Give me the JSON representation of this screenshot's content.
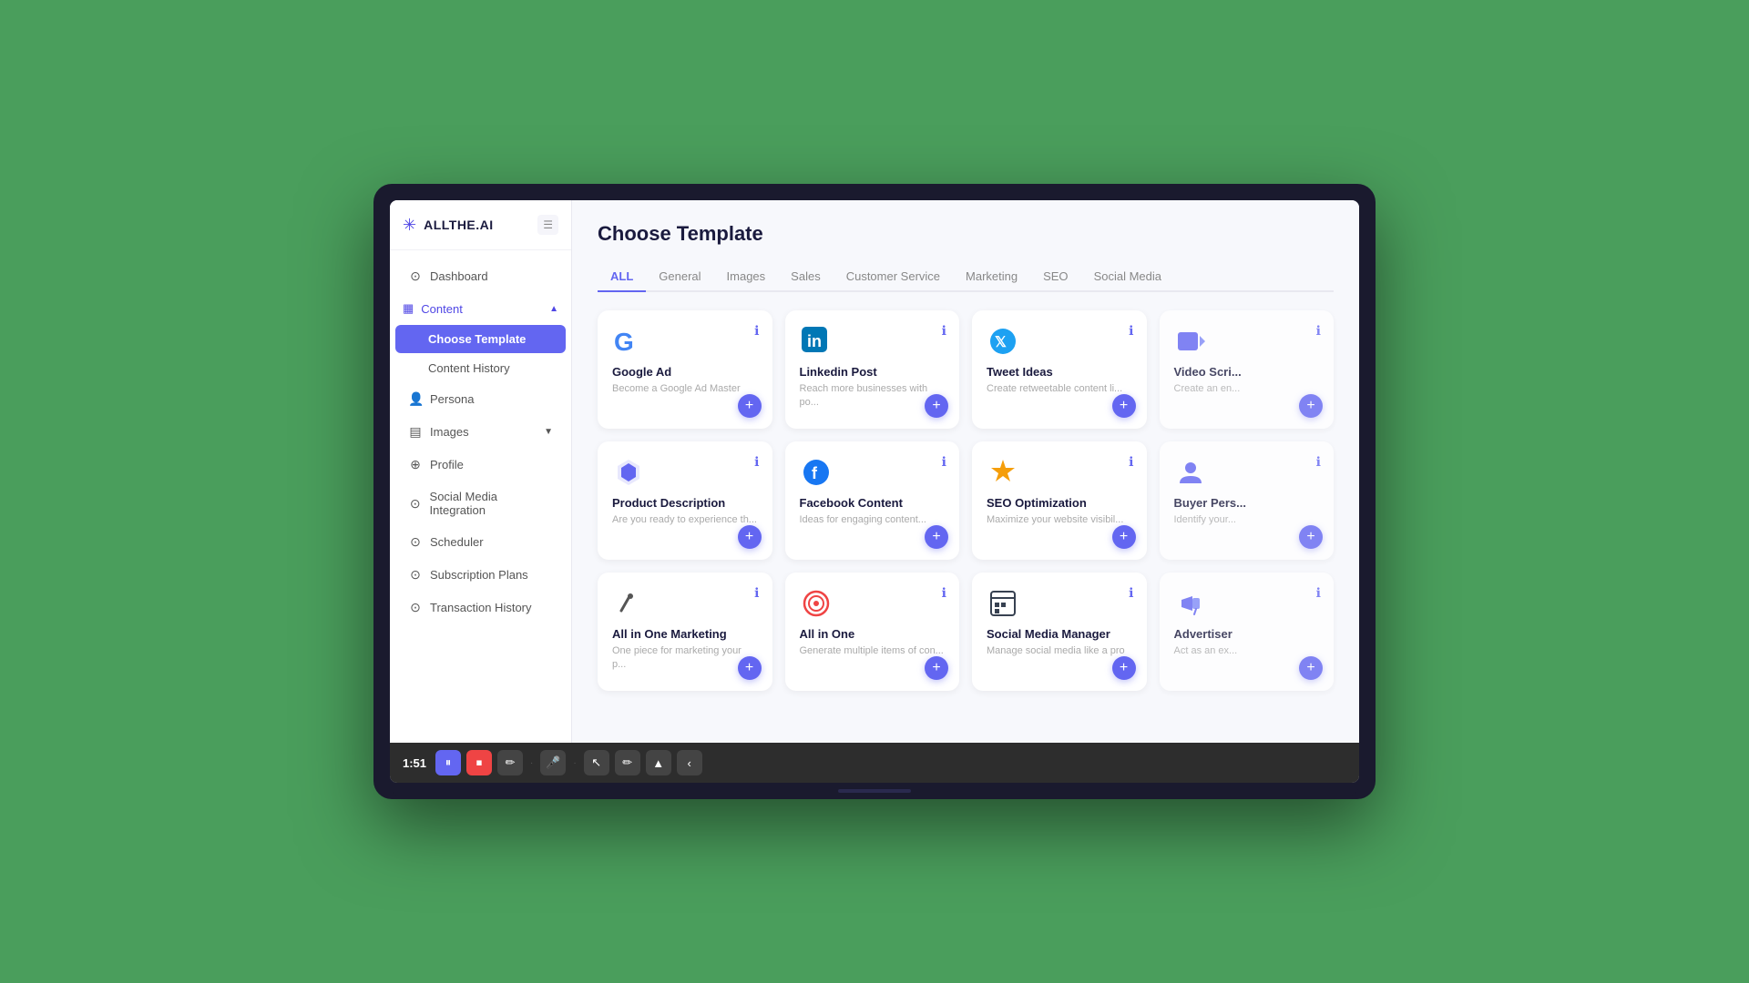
{
  "logo": {
    "icon": "✳",
    "text": "ALLTHE.AI"
  },
  "menu_button": "☰",
  "sidebar": {
    "items": [
      {
        "id": "dashboard",
        "label": "Dashboard",
        "icon": "⊙",
        "active": false
      },
      {
        "id": "content",
        "label": "Content",
        "icon": "▦",
        "active": true,
        "expandable": true,
        "expanded": true
      },
      {
        "id": "choose-template",
        "label": "Choose Template",
        "active": true,
        "sub": true
      },
      {
        "id": "content-history",
        "label": "Content History",
        "active": false,
        "sub": true
      },
      {
        "id": "persona",
        "label": "Persona",
        "icon": "👤",
        "active": false
      },
      {
        "id": "images",
        "label": "Images",
        "icon": "▤",
        "active": false,
        "expandable": true
      },
      {
        "id": "profile",
        "label": "Profile",
        "icon": "⊕",
        "active": false
      },
      {
        "id": "social-media-integration",
        "label": "Social Media Integration",
        "icon": "⊙",
        "active": false
      },
      {
        "id": "scheduler",
        "label": "Scheduler",
        "icon": "⊙",
        "active": false
      },
      {
        "id": "subscription-plans",
        "label": "Subscription Plans",
        "icon": "⊙",
        "active": false
      },
      {
        "id": "transaction-history",
        "label": "Transaction History",
        "icon": "⊙",
        "active": false
      }
    ]
  },
  "page": {
    "title": "Choose Template",
    "tabs": [
      {
        "id": "all",
        "label": "ALL",
        "active": true
      },
      {
        "id": "general",
        "label": "General",
        "active": false
      },
      {
        "id": "images",
        "label": "Images",
        "active": false
      },
      {
        "id": "sales",
        "label": "Sales",
        "active": false
      },
      {
        "id": "customer-service",
        "label": "Customer Service",
        "active": false
      },
      {
        "id": "marketing",
        "label": "Marketing",
        "active": false
      },
      {
        "id": "seo",
        "label": "SEO",
        "active": false
      },
      {
        "id": "social-media",
        "label": "Social Media",
        "active": false
      }
    ]
  },
  "templates": [
    {
      "id": "google-ad",
      "name": "Google Ad",
      "desc": "Become a Google Ad Master",
      "icon_type": "google",
      "color": "#4285F4"
    },
    {
      "id": "linkedin-post",
      "name": "Linkedin Post",
      "desc": "Reach more businesses with po...",
      "icon_type": "linkedin",
      "color": "#0077B5"
    },
    {
      "id": "tweet-ideas",
      "name": "Tweet Ideas",
      "desc": "Create retweetable content li...",
      "icon_type": "twitter",
      "color": "#1DA1F2"
    },
    {
      "id": "video-script",
      "name": "Video Scri...",
      "desc": "Create an en...",
      "icon_type": "video",
      "color": "#FF0000",
      "partial": true
    },
    {
      "id": "product-description",
      "name": "Product Description",
      "desc": "Are you ready to experience th...",
      "icon_type": "diamond",
      "color": "#6366f1"
    },
    {
      "id": "facebook-content",
      "name": "Facebook Content",
      "desc": "Ideas for engaging content...",
      "icon_type": "facebook",
      "color": "#1877F2"
    },
    {
      "id": "seo-optimization",
      "name": "SEO Optimization",
      "desc": "Maximize your website visibil...",
      "icon_type": "trophy",
      "color": "#f59e0b"
    },
    {
      "id": "buyer-persona",
      "name": "Buyer Pers...",
      "desc": "Identify your...",
      "icon_type": "person",
      "color": "#6366f1",
      "partial": true
    },
    {
      "id": "all-in-one-marketing",
      "name": "All in One Marketing",
      "desc": "One piece for marketing your p...",
      "icon_type": "pen",
      "color": "#555"
    },
    {
      "id": "all-in-one",
      "name": "All in One",
      "desc": "Generate multiple items of con...",
      "icon_type": "target",
      "color": "#ef4444"
    },
    {
      "id": "social-media-manager",
      "name": "Social Media Manager",
      "desc": "Manage social media like a pro",
      "icon_type": "calendar",
      "color": "#374151"
    },
    {
      "id": "advertiser",
      "name": "Advertiser",
      "desc": "Act as an ex...",
      "icon_type": "megaphone",
      "color": "#6366f1",
      "partial": true
    }
  ],
  "toolbar": {
    "time": "1:51",
    "buttons": [
      {
        "id": "pause",
        "icon": "⏸",
        "type": "blue"
      },
      {
        "id": "stop",
        "icon": "⏹",
        "type": "red"
      },
      {
        "id": "tool1",
        "icon": "✏",
        "type": "dark"
      },
      {
        "id": "tool2",
        "icon": "🎤",
        "type": "dark"
      },
      {
        "id": "arrow",
        "icon": "↖",
        "type": "dark"
      },
      {
        "id": "draw",
        "icon": "✏",
        "type": "dark"
      },
      {
        "id": "highlight",
        "icon": "▲",
        "type": "dark"
      },
      {
        "id": "more",
        "icon": "‹",
        "type": "dark"
      }
    ]
  }
}
